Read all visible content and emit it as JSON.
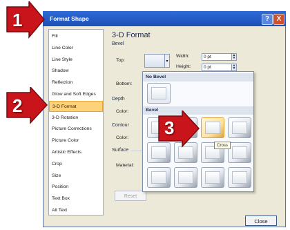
{
  "dialog": {
    "title": "Format Shape",
    "help_glyph": "?",
    "close_glyph": "X"
  },
  "categories": [
    {
      "label": "Fill"
    },
    {
      "label": "Line Color"
    },
    {
      "label": "Line Style"
    },
    {
      "label": "Shadow"
    },
    {
      "label": "Reflection"
    },
    {
      "label": "Glow and Soft Edges"
    },
    {
      "label": "3-D Format",
      "selected": true
    },
    {
      "label": "3-D Rotation"
    },
    {
      "label": "Picture Corrections"
    },
    {
      "label": "Picture Color"
    },
    {
      "label": "Artistic Effects"
    },
    {
      "label": "Crop"
    },
    {
      "label": "Size"
    },
    {
      "label": "Position"
    },
    {
      "label": "Text Box"
    },
    {
      "label": "Alt Text"
    }
  ],
  "pane": {
    "heading": "3-D Format",
    "bevel_section": "Bevel",
    "top_label": "Top:",
    "bottom_label": "Bottom:",
    "width_label": "Width:",
    "height_label": "Height:",
    "width_value": "0 pt",
    "height_value": "0 pt",
    "depth_label": "Depth",
    "depth_color_label": "Color:",
    "contour_label": "Contour",
    "contour_color_label": "Color:",
    "surface_label": "Surface",
    "material_label": "Material:",
    "reset_label": "Reset",
    "close_label": "Close"
  },
  "bevel_gallery": {
    "no_bevel_header": "No Bevel",
    "bevel_header": "Bevel",
    "hovered_tooltip": "Cross"
  },
  "callouts": [
    "1",
    "2",
    "3"
  ],
  "colors": {
    "titlebar": "#1b4fb6",
    "selection": "#ffd27a",
    "callout_red": "#c8141a"
  }
}
